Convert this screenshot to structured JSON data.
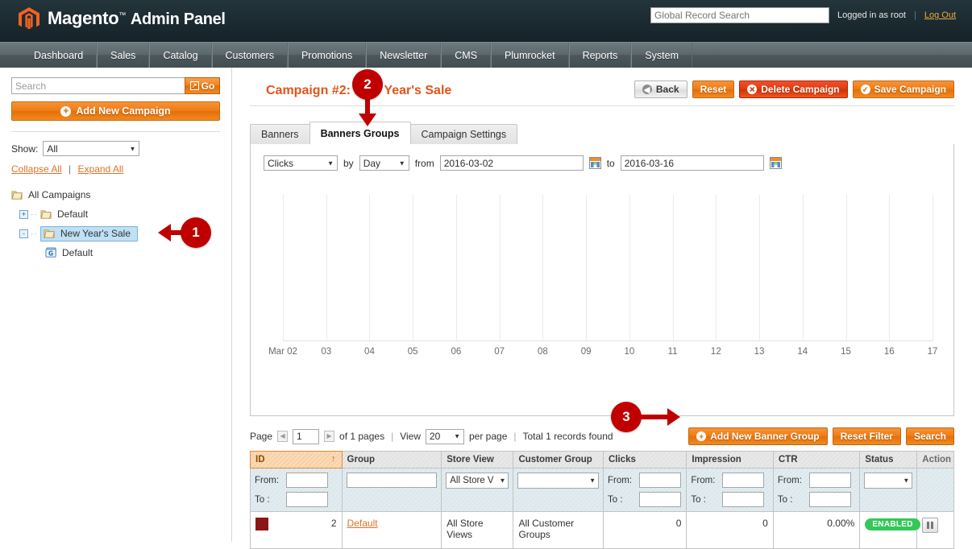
{
  "header": {
    "logo_text": "Magento",
    "logo_tm": "™",
    "logo_suffix": "Admin Panel",
    "search_placeholder": "Global Record Search",
    "search_value": "",
    "logged_in_text": "Logged in as root",
    "separator": "|",
    "logout_label": "Log Out",
    "logo_icon": "magento-orb-icon"
  },
  "nav": {
    "items": [
      {
        "label": "Dashboard"
      },
      {
        "label": "Sales"
      },
      {
        "label": "Catalog"
      },
      {
        "label": "Customers"
      },
      {
        "label": "Promotions"
      },
      {
        "label": "Newsletter"
      },
      {
        "label": "CMS"
      },
      {
        "label": "Plumrocket"
      },
      {
        "label": "Reports"
      },
      {
        "label": "System"
      }
    ]
  },
  "sidebar": {
    "search_placeholder": "Search",
    "search_value": "",
    "go_label": "Go",
    "go_icon": "arrow-box-icon",
    "add_campaign_label": "Add New Campaign",
    "add_icon": "plus-circle-icon",
    "show_label": "Show:",
    "show_value": "All",
    "collapse_all": "Collapse All",
    "expand_all": "Expand All",
    "links_separator": "|",
    "tree": [
      {
        "label": "All Campaigns",
        "level": 0,
        "toggle": "",
        "icon": "folder-icon",
        "selected": false
      },
      {
        "label": "Default",
        "level": 1,
        "toggle": "+",
        "icon": "folder-icon",
        "selected": false
      },
      {
        "label": "New Year's Sale",
        "level": 1,
        "toggle": "-",
        "icon": "folder-icon",
        "selected": true
      },
      {
        "label": "Default",
        "level": 2,
        "toggle": "",
        "icon": "group-icon",
        "selected": false
      }
    ]
  },
  "main": {
    "page_title": "Campaign #2: New Year's Sale",
    "buttons": {
      "back": "Back",
      "back_icon": "back-arrow-icon",
      "reset": "Reset",
      "delete": "Delete Campaign",
      "delete_icon": "x-circle-icon",
      "save": "Save Campaign",
      "save_icon": "check-circle-icon"
    },
    "tabs": [
      {
        "label": "Banners",
        "active": false
      },
      {
        "label": "Banners Groups",
        "active": true
      },
      {
        "label": "Campaign Settings",
        "active": false
      }
    ],
    "chart_filter": {
      "metric": "Clicks",
      "by_label": "by",
      "period": "Day",
      "from_label": "from",
      "from_value": "2016-03-02",
      "to_label": "to",
      "to_value": "2016-03-16",
      "calendar_icon": "calendar-icon"
    }
  },
  "chart_data": {
    "type": "line",
    "title": "",
    "xlabel": "",
    "ylabel": "",
    "categories": [
      "Mar 02",
      "03",
      "04",
      "05",
      "06",
      "07",
      "08",
      "09",
      "10",
      "11",
      "12",
      "13",
      "14",
      "15",
      "16",
      "17"
    ],
    "series": [
      {
        "name": "Clicks",
        "values": [
          0,
          0,
          0,
          0,
          0,
          0,
          0,
          0,
          0,
          0,
          0,
          0,
          0,
          0,
          0,
          0
        ]
      }
    ],
    "ylim": [
      0,
      0
    ],
    "grid": true,
    "legend": "none",
    "note": "empty plot — vertical gridlines only, no plotted data"
  },
  "grid": {
    "pager": {
      "page_label": "Page",
      "page_value": "1",
      "of_pages": "of 1 pages",
      "view_label": "View",
      "per_page_value": "20",
      "per_page_label": "per page",
      "total_records": "Total 1 records found",
      "prev_icon": "chevron-left-icon",
      "next_icon": "chevron-right-icon",
      "divider": "|"
    },
    "actions": {
      "add_banner_group": "Add New Banner Group",
      "add_icon": "plus-circle-icon",
      "reset_filter": "Reset Filter",
      "search": "Search"
    },
    "columns": [
      {
        "label": "ID",
        "sorted": true,
        "sort_icon": "sort-asc-icon"
      },
      {
        "label": "Group",
        "sorted": false
      },
      {
        "label": "Store View",
        "sorted": false
      },
      {
        "label": "Customer Group",
        "sorted": false
      },
      {
        "label": "Clicks",
        "sorted": false
      },
      {
        "label": "Impression",
        "sorted": false
      },
      {
        "label": "CTR",
        "sorted": false
      },
      {
        "label": "Status",
        "sorted": false
      },
      {
        "label": "Action",
        "sorted": false
      }
    ],
    "filters": {
      "from_label": "From:",
      "to_label": "To :",
      "id_from": "",
      "id_to": "",
      "group": "",
      "store_view": "All Store V",
      "customer_group": "",
      "clicks_from": "",
      "clicks_to": "",
      "impression_from": "",
      "impression_to": "",
      "ctr_from": "",
      "ctr_to": "",
      "status": ""
    },
    "rows": [
      {
        "color": "#8b1616",
        "id": "2",
        "group": "Default",
        "store_view": "All Store Views",
        "customer_group": "All Customer Groups",
        "clicks": "0",
        "impression": "0",
        "ctr": "0.00%",
        "status": "ENABLED",
        "action_icon": "pause-icon"
      }
    ]
  },
  "annotations": [
    {
      "number": "1",
      "target": "sidebar-tree-new-years-sale",
      "direction": "left"
    },
    {
      "number": "2",
      "target": "tab-banners-groups",
      "direction": "down"
    },
    {
      "number": "3",
      "target": "add-new-banner-group-button",
      "direction": "right"
    }
  ],
  "colors": {
    "brand_orange": "#e8770c",
    "title_orange": "#e2541b",
    "annotation_red": "#c00000",
    "status_green": "#34c759",
    "header_dark": "#1b2a30"
  }
}
